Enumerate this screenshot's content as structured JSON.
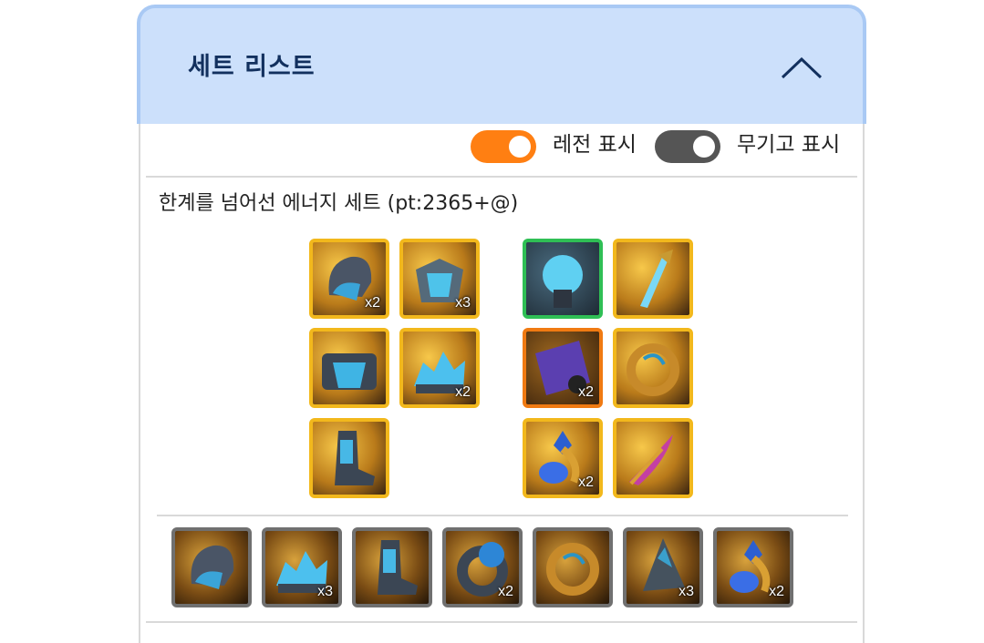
{
  "header": {
    "title": "세트 리스트",
    "collapse_icon": "chevron-up-icon",
    "background": "#cce0fb"
  },
  "toggles": {
    "legend": {
      "label": "레전 표시",
      "on": true,
      "color": "#ff7f12"
    },
    "weapon_only": {
      "label": "무기고 표시",
      "on": true,
      "color": "#555555"
    }
  },
  "set": {
    "title": "한계를 넘어선 에너지 세트 (pt:2365+@)",
    "left_items": [
      {
        "icon": "helmet-icon",
        "count": "x2",
        "border": "#f2b81c"
      },
      {
        "icon": "chest-armor-icon",
        "count": "x3",
        "border": "#f2b81c"
      },
      {
        "icon": "shoulder-armor-icon",
        "count": "",
        "border": "#f2b81c"
      },
      {
        "icon": "crystal-gloves-icon",
        "count": "x2",
        "border": "#f2b81c"
      },
      {
        "icon": "boots-icon",
        "count": "",
        "border": "#f2b81c"
      }
    ],
    "right_items": [
      {
        "icon": "energy-orb-icon",
        "count": "",
        "border": "#2fbf55"
      },
      {
        "icon": "sword-icon",
        "count": "",
        "border": "#f2b81c"
      },
      {
        "icon": "purple-tome-icon",
        "count": "x2",
        "border": "#f07a12"
      },
      {
        "icon": "gold-ring-icon",
        "count": "",
        "border": "#f2b81c"
      },
      {
        "icon": "gold-amulet-icon",
        "count": "x2",
        "border": "#f2b81c"
      },
      {
        "icon": "pink-feather-icon",
        "count": "",
        "border": "#f2b81c"
      }
    ],
    "bottom_items": [
      {
        "icon": "helmet-icon",
        "count": ""
      },
      {
        "icon": "crystal-gloves-icon",
        "count": "x3"
      },
      {
        "icon": "boots-icon",
        "count": ""
      },
      {
        "icon": "blue-gem-ring-icon",
        "count": "x2"
      },
      {
        "icon": "gold-ring-icon",
        "count": ""
      },
      {
        "icon": "dark-shard-icon",
        "count": "x3"
      },
      {
        "icon": "gold-amulet-icon",
        "count": "x2"
      }
    ]
  }
}
